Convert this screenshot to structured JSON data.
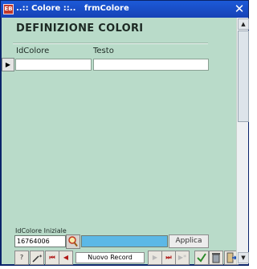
{
  "window": {
    "title": "..:: Colore ::..   frmColore",
    "icon": "access-form-icon"
  },
  "form": {
    "title": "DEFINIZIONE COLORI",
    "columns": [
      "IdColore",
      "Testo"
    ],
    "row": {
      "id_colore": "",
      "testo": ""
    }
  },
  "footer": {
    "initial_label": "IdColore Iniziale",
    "initial_value": "16764006",
    "search_icon": "search-icon",
    "color_swatch": "#5cb8e6",
    "apply_label": "Applica"
  },
  "navigation": {
    "help": "?",
    "first": "⏮",
    "prev": "◀",
    "status": "Nuovo Record",
    "next": "▶",
    "last": "⏭",
    "new": "▶*"
  }
}
